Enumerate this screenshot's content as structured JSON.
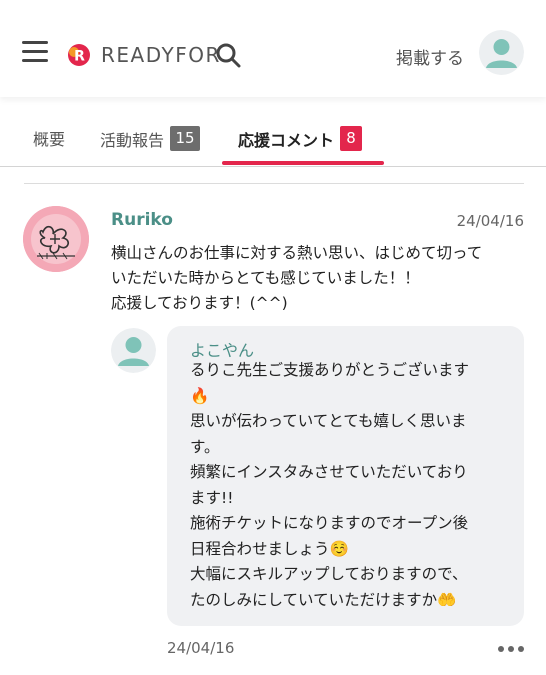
{
  "header": {
    "logo_text": "READYFOR",
    "post_label": "掲載する",
    "icons": [
      "menu-icon",
      "readyfor-logo-mark",
      "search-icon",
      "user-avatar-icon"
    ]
  },
  "tabs": [
    {
      "label": "概要"
    },
    {
      "label": "活動報告",
      "count": "15"
    },
    {
      "label": "応援コメント",
      "count": "8",
      "active": true
    }
  ],
  "comment": {
    "author": "Ruriko",
    "date": "24/04/16",
    "body": "横山さんのお仕事に対する熱い思い、はじめて切って\nいただいた時からとても感じていました！！\n応援しております！(^^)",
    "reply": {
      "author": "よこやん",
      "body": "るりこ先生ご支援ありがとうございます\n🔥\n思いが伝わっていてとても嬉しく思いま\nす。\n頻繁にインスタみさせていただいており\nます!!\n施術チケットになりますのでオープン後\n日程合わせましょう☺️\n大幅にスキルアップしておりますので、\nたのしみにしていていただけますか🤲",
      "date": "24/04/16"
    }
  },
  "colors": {
    "brand_red": "#e3264c",
    "teal_name": "#4b8f87",
    "bubble_bg": "#f0f1f3",
    "avatar_teal": "#7fc3b8"
  }
}
